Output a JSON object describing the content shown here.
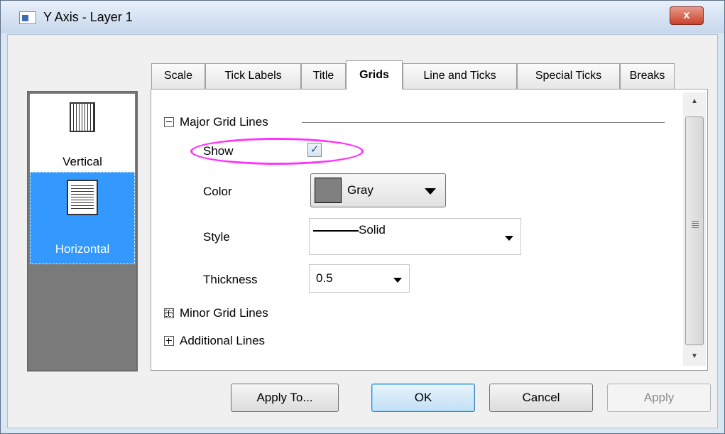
{
  "window": {
    "title": "Y Axis - Layer 1",
    "close_label": "x"
  },
  "left_list": {
    "items": [
      {
        "label": "Vertical",
        "selected": false
      },
      {
        "label": "Horizontal",
        "selected": true
      }
    ]
  },
  "tabs": [
    {
      "label": "Scale"
    },
    {
      "label": "Tick Labels"
    },
    {
      "label": "Title"
    },
    {
      "label": "Grids",
      "active": true
    },
    {
      "label": "Line and Ticks"
    },
    {
      "label": "Special Ticks"
    },
    {
      "label": "Breaks"
    }
  ],
  "grids": {
    "major_section": "Major Grid Lines",
    "show_label": "Show",
    "show_checked": true,
    "show_check_glyph": "✓",
    "color_label": "Color",
    "color_value": "Gray",
    "color_swatch": "#808080",
    "style_label": "Style",
    "style_value": "Solid",
    "thickness_label": "Thickness",
    "thickness_value": "0.5",
    "minor_section": "Minor Grid Lines",
    "additional_section": "Additional Lines"
  },
  "buttons": {
    "apply_to": "Apply To...",
    "ok": "OK",
    "cancel": "Cancel",
    "apply": "Apply"
  },
  "scrollbar": {
    "up_glyph": "▲",
    "down_glyph": "▼"
  }
}
